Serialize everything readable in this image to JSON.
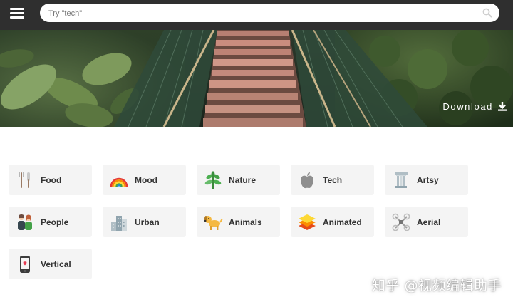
{
  "search": {
    "placeholder": "Try \"tech\"",
    "value": ""
  },
  "hero": {
    "download_label": "Download"
  },
  "categories": [
    {
      "label": "Food",
      "icon": "food-icon"
    },
    {
      "label": "Mood",
      "icon": "rainbow-icon"
    },
    {
      "label": "Nature",
      "icon": "seedling-icon"
    },
    {
      "label": "Tech",
      "icon": "apple-icon"
    },
    {
      "label": "Artsy",
      "icon": "column-icon"
    },
    {
      "label": "People",
      "icon": "couple-icon"
    },
    {
      "label": "Urban",
      "icon": "buildings-icon"
    },
    {
      "label": "Animals",
      "icon": "dog-icon"
    },
    {
      "label": "Animated",
      "icon": "layers-icon"
    },
    {
      "label": "Aerial",
      "icon": "drone-icon"
    },
    {
      "label": "Vertical",
      "icon": "phone-icon"
    }
  ],
  "watermark": "知乎 @视频编辑助手",
  "colors": {
    "topbar": "#2f2f2f",
    "tile_bg": "#f4f4f4",
    "text": "#333333"
  }
}
